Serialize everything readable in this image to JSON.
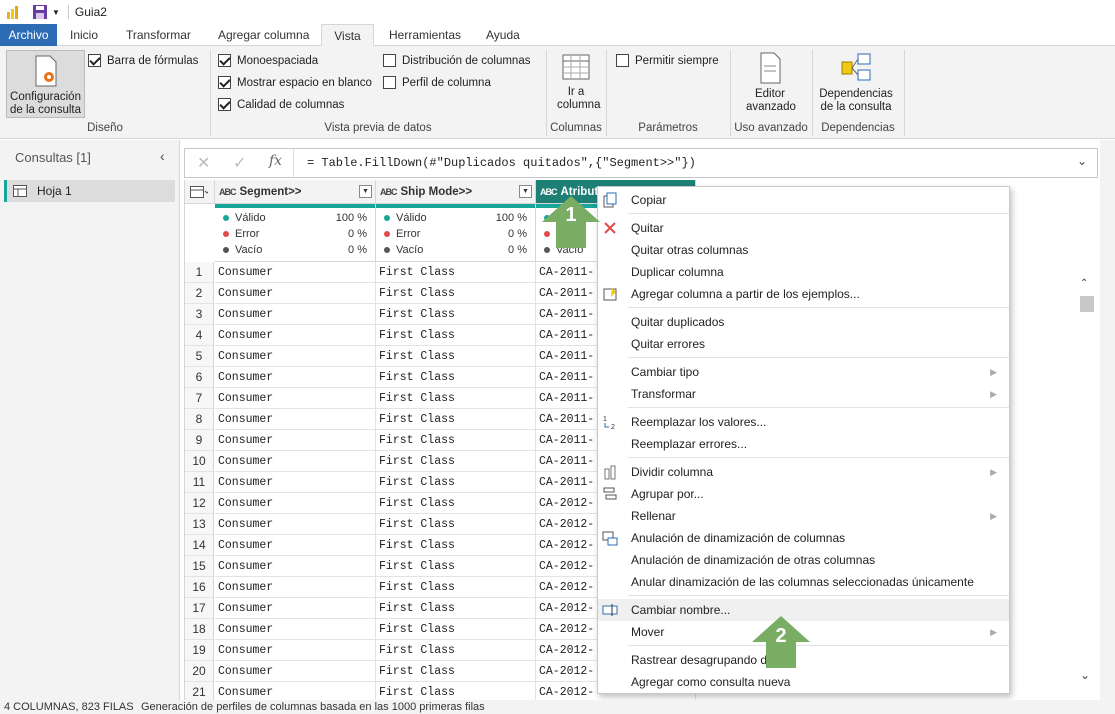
{
  "window": {
    "title": "Guia2"
  },
  "tabs": [
    "Archivo",
    "Inicio",
    "Transformar",
    "Agregar columna",
    "Vista",
    "Herramientas",
    "Ayuda"
  ],
  "ribbon": {
    "query_settings": "Configuración de la consulta",
    "formula_bar": "Barra de fórmulas",
    "group_diseno": "Diseño",
    "monospaced": "Monoespaciada",
    "show_whitespace": "Mostrar espacio en blanco",
    "column_quality": "Calidad de columnas",
    "column_distribution": "Distribución de columnas",
    "column_profile": "Perfil de columna",
    "group_preview": "Vista previa de datos",
    "go_to_column": "Ir a columna",
    "group_columns": "Columnas",
    "always_allow": "Permitir siempre",
    "group_params": "Parámetros",
    "advanced_editor": "Editor avanzado",
    "group_advanced": "Uso avanzado",
    "query_dependencies": "Dependencias de la consulta",
    "group_dependencies": "Dependencias"
  },
  "left_pane": {
    "title": "Consultas [1]",
    "query": "Hoja 1"
  },
  "formula": {
    "text": "= Table.FillDown(#\"Duplicados quitados\",{\"Segment>>\"})"
  },
  "columns": [
    {
      "name": "Segment>>",
      "type": "ABC"
    },
    {
      "name": "Ship Mode>>",
      "type": "ABC"
    },
    {
      "name": "Atribut",
      "type": "ABC"
    }
  ],
  "quality": {
    "valid_label": "Válido",
    "valid_value": "100 %",
    "error_label": "Error",
    "error_value": "0 %",
    "empty_label": "Vacío",
    "empty_value": "0 %"
  },
  "rows": [
    [
      "1",
      "Consumer",
      "First Class",
      "CA-2011-"
    ],
    [
      "2",
      "Consumer",
      "First Class",
      "CA-2011-"
    ],
    [
      "3",
      "Consumer",
      "First Class",
      "CA-2011-"
    ],
    [
      "4",
      "Consumer",
      "First Class",
      "CA-2011-"
    ],
    [
      "5",
      "Consumer",
      "First Class",
      "CA-2011-"
    ],
    [
      "6",
      "Consumer",
      "First Class",
      "CA-2011-"
    ],
    [
      "7",
      "Consumer",
      "First Class",
      "CA-2011-"
    ],
    [
      "8",
      "Consumer",
      "First Class",
      "CA-2011-"
    ],
    [
      "9",
      "Consumer",
      "First Class",
      "CA-2011-"
    ],
    [
      "10",
      "Consumer",
      "First Class",
      "CA-2011-"
    ],
    [
      "11",
      "Consumer",
      "First Class",
      "CA-2011-"
    ],
    [
      "12",
      "Consumer",
      "First Class",
      "CA-2012-"
    ],
    [
      "13",
      "Consumer",
      "First Class",
      "CA-2012-"
    ],
    [
      "14",
      "Consumer",
      "First Class",
      "CA-2012-"
    ],
    [
      "15",
      "Consumer",
      "First Class",
      "CA-2012-"
    ],
    [
      "16",
      "Consumer",
      "First Class",
      "CA-2012-"
    ],
    [
      "17",
      "Consumer",
      "First Class",
      "CA-2012-"
    ],
    [
      "18",
      "Consumer",
      "First Class",
      "CA-2012-"
    ],
    [
      "19",
      "Consumer",
      "First Class",
      "CA-2012-"
    ],
    [
      "20",
      "Consumer",
      "First Class",
      "CA-2012-"
    ],
    [
      "21",
      "Consumer",
      "First Class",
      "CA-2012-"
    ]
  ],
  "context_menu": [
    {
      "label": "Copiar",
      "icon": "copy-icon"
    },
    {
      "sep": true
    },
    {
      "label": "Quitar",
      "icon": "remove-icon"
    },
    {
      "label": "Quitar otras columnas"
    },
    {
      "label": "Duplicar columna"
    },
    {
      "label": "Agregar columna a partir de los ejemplos...",
      "icon": "column-from-examples-icon"
    },
    {
      "sep": true
    },
    {
      "label": "Quitar duplicados"
    },
    {
      "label": "Quitar errores"
    },
    {
      "sep": true
    },
    {
      "label": "Cambiar tipo",
      "submenu": true
    },
    {
      "label": "Transformar",
      "submenu": true
    },
    {
      "sep": true
    },
    {
      "label": "Reemplazar los valores...",
      "icon": "replace-values-icon"
    },
    {
      "label": "Reemplazar errores..."
    },
    {
      "sep": true
    },
    {
      "label": "Dividir columna",
      "icon": "split-column-icon",
      "submenu": true
    },
    {
      "label": "Agrupar por...",
      "icon": "group-by-icon"
    },
    {
      "label": "Rellenar",
      "submenu": true
    },
    {
      "label": "Anulación de dinamización de columnas",
      "icon": "unpivot-icon"
    },
    {
      "label": "Anulación de dinamización de otras columnas"
    },
    {
      "label": "Anular dinamización de las columnas seleccionadas únicamente"
    },
    {
      "sep": true
    },
    {
      "label": "Cambiar nombre...",
      "icon": "rename-icon",
      "highlighted": true
    },
    {
      "label": "Mover",
      "submenu": true
    },
    {
      "sep": true
    },
    {
      "label": "Rastrear desagrupando da"
    },
    {
      "label": "Agregar como consulta nueva"
    }
  ],
  "annotations": [
    "1",
    "2"
  ],
  "status": {
    "columns_rows": "4 COLUMNAS, 823 FILAS",
    "profiling": "Generación de perfiles de columnas basada en las 1000 primeras filas"
  },
  "colors": {
    "accent": "#2b6cb5",
    "quality_bar": "#17a69a",
    "badge": "#79ad63",
    "valid": "#17a69a",
    "error": "#e04b4b",
    "empty": "#555555"
  }
}
